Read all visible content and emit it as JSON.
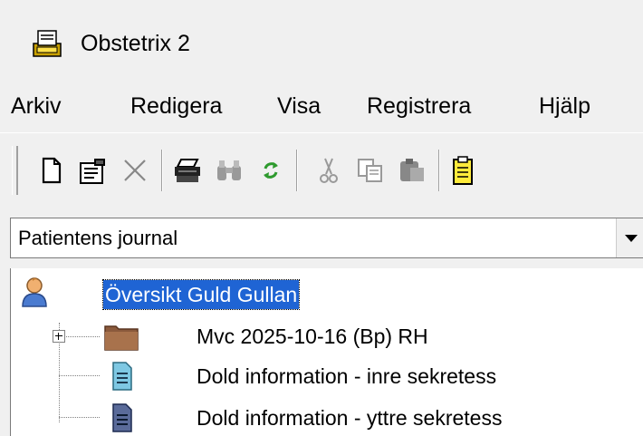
{
  "window": {
    "title": "Obstetrix 2"
  },
  "menu": [
    "Arkiv",
    "Redigera",
    "Visa",
    "Registrera",
    "Hjälp"
  ],
  "toolbar": {
    "buttons": [
      {
        "name": "new-document-icon"
      },
      {
        "name": "properties-icon"
      },
      {
        "name": "delete-icon"
      },
      {
        "name": "print-icon"
      },
      {
        "name": "find-icon"
      },
      {
        "name": "refresh-icon"
      },
      {
        "name": "cut-icon"
      },
      {
        "name": "copy-icon"
      },
      {
        "name": "paste-icon"
      },
      {
        "name": "clipboard-icon"
      }
    ]
  },
  "journal_select": {
    "value": "Patientens journal"
  },
  "tree": {
    "root": {
      "label": "Översikt Guld Gullan",
      "icon": "person-icon"
    },
    "children": [
      {
        "label": "Mvc 2025-10-16 (Bp)  RH",
        "icon": "folder-icon",
        "expandable": true
      },
      {
        "label": "Dold information - inre sekretess",
        "icon": "document-light-icon"
      },
      {
        "label": "Dold information - yttre sekretess",
        "icon": "document-dark-icon"
      }
    ]
  },
  "colors": {
    "selection": "#1f64d4",
    "folder": "#8b5a3c",
    "doc_light": "#7ec8e3",
    "doc_dark": "#5a6b9a"
  }
}
